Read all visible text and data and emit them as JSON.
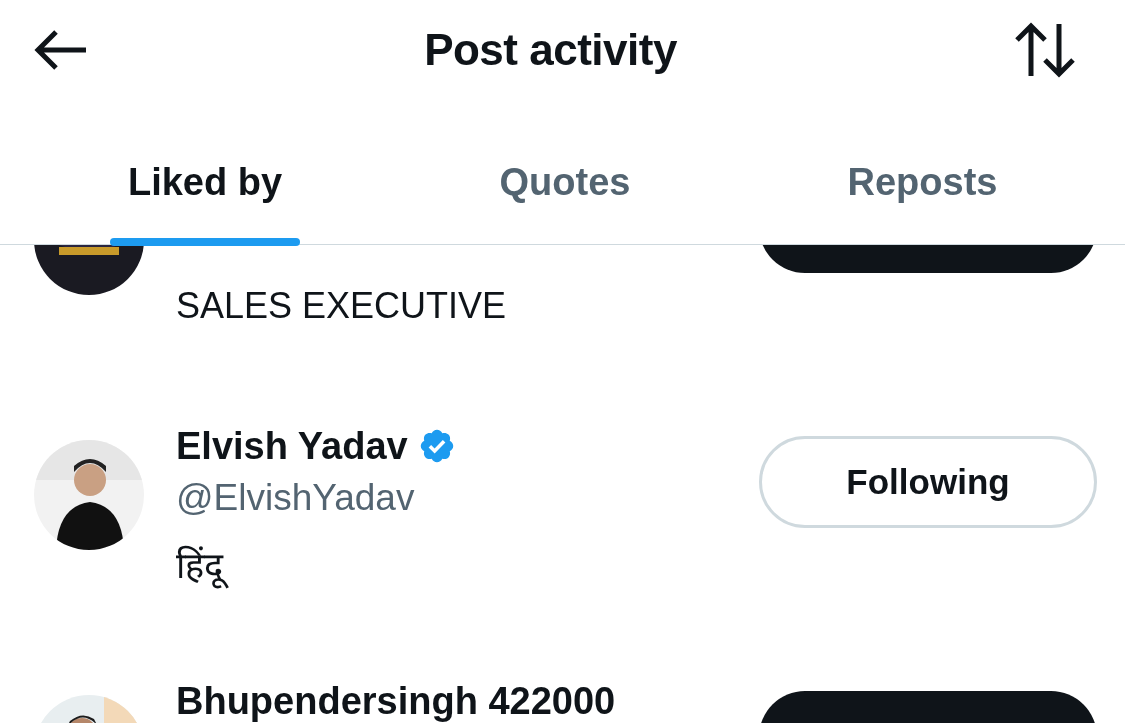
{
  "header": {
    "title": "Post activity"
  },
  "tabs": [
    {
      "label": "Liked by",
      "selected": true
    },
    {
      "label": "Quotes",
      "selected": false
    },
    {
      "label": "Reposts",
      "selected": false
    }
  ],
  "users": [
    {
      "verified": false,
      "bio": "SALES EXECUTIVE",
      "button": {
        "kind": "follow"
      }
    },
    {
      "name": "Elvish Yadav",
      "handle": "@ElvishYadav",
      "verified": true,
      "bio": "हिंदू",
      "button": {
        "kind": "following",
        "label": "Following"
      }
    },
    {
      "name": "Bhupendersingh 422000",
      "verified": false,
      "button": {
        "kind": "follow"
      }
    }
  ]
}
